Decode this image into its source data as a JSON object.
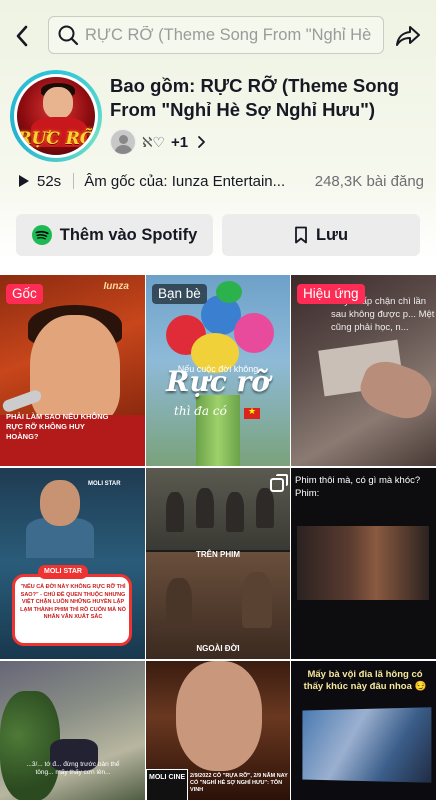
{
  "search": {
    "placeholder": "RỰC RỠ (Theme Song From \"Nghỉ Hè S..."
  },
  "header": {
    "album_logo": "RỰC RỠ",
    "title": "Bao gồm: RỰC RỠ (Theme Song From \"Nghỉ Hè Sợ Nghỉ Hưu\")",
    "creator_handle": "ℵ♡",
    "creator_more": "+1"
  },
  "stats": {
    "duration": "52s",
    "original_sound": "Âm gốc của: Iunza Entertain...",
    "posts": "248,3K bài đăng"
  },
  "buttons": {
    "spotify_label": "Thêm vào Spotify",
    "save_label": "Lưu"
  },
  "grid": {
    "tiles": [
      {
        "badge": "Gốc",
        "brand": "Iunza",
        "caption": "PHẢI LÀM SAO NẾU KHÔNG RỰC RỠ KHÔNG HUY HOÀNG?"
      },
      {
        "badge": "Bạn bè",
        "small": "Nếu cuộc đời không",
        "big": "Rực rỡ",
        "small2": "thì đa có"
      },
      {
        "badge": "Hiệu ứng",
        "caption": "...ay chấp chận chì lần sau không được p... Mệt cũng phải học, n..."
      },
      {
        "moli_top": "MOLI STAR",
        "moli_pill": "MOLI STAR",
        "panel": "\"NẾU CẢ ĐỜI NÀY KHÔNG RỰC RỠ THÌ SAO?\" - CHỦ ĐỀ QUEN THUỘC NHƯNG VIỆT CHẶN LUÔN NHỮNG HUYỀN LẬP LẠM THÀNH PHIM THÌ RỒ CUỐN MÀ NÓ NHÂN VĂN XUẤT SẮC"
      },
      {
        "label_top": "TRÊN PHIM",
        "label_bottom": "NGOÀI ĐỜI"
      },
      {
        "caption": "Phim thôi mà, có gì mà khóc? Phim:"
      },
      {
        "caption": "...3/... tớ đ... đừng trước bản thể tông... mấy thấy cơn lên..."
      },
      {
        "cine": "MOLI CINE",
        "caption": "2/9/2022 CÔ \"RỰA RỠ\", 2/9 NĂM NAY CÓ \"NGHỈ HÈ SỢ NGHỈ HƯU\": TÔN VINH"
      },
      {
        "caption": "Mấy bà vội đia lã hông có thấy khúc này đâu nhoa 😏"
      }
    ]
  },
  "colors": {
    "accent_red": "#fe2c55",
    "spotify_green": "#1db954",
    "ring": "#2ec4d8"
  },
  "icons": [
    "back-arrow-icon",
    "search-icon",
    "share-icon",
    "play-icon",
    "chevron-right-icon",
    "spotify-icon",
    "bookmark-icon",
    "multi-photo-icon"
  ]
}
